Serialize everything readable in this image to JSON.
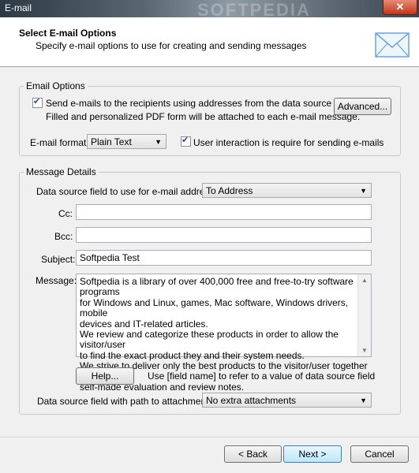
{
  "window": {
    "title": "E-mail",
    "close": "✕",
    "watermark": "SOFTPEDIA"
  },
  "header": {
    "title": "Select E-mail Options",
    "subtitle": "Specify e-mail options to use for creating and sending messages"
  },
  "email_options": {
    "group_label": "Email Options",
    "send_label": "Send e-mails to the recipients using addresses from the data source",
    "send_checked": true,
    "attach_note": "Filled and personalized PDF form will be attached to each e-mail message.",
    "advanced_button": "Advanced...",
    "format_label": "E-mail format:",
    "format_value": "Plain Text",
    "interaction_label": "User interaction is require for sending e-mails",
    "interaction_checked": true
  },
  "message_details": {
    "group_label": "Message Details",
    "address_field_label": "Data source field to use for e-mail address:",
    "address_field_value": "To Address",
    "cc_label": "Cc:",
    "cc_value": "",
    "bcc_label": "Bcc:",
    "bcc_value": "",
    "subject_label": "Subject:",
    "subject_value": "Softpedia Test",
    "message_label": "Message:",
    "message_lines": [
      "Softpedia is a library of over 400,000 free and free-to-try software programs",
      "for Windows and Linux, games, Mac software, Windows drivers, mobile",
      "devices and IT-related articles.",
      "We review and categorize these products in order to allow the visitor/user",
      "to find the exact product they and their system needs.",
      "We strive to deliver only the best products to the visitor/user together with",
      "self-made evaluation and review notes."
    ],
    "help_button": "Help...",
    "help_hint": "Use [field name] to refer to a value of data source field",
    "attachment_label": "Data source field with path to attachment:",
    "attachment_value": "No extra attachments"
  },
  "footer": {
    "back": "< Back",
    "next": "Next >",
    "cancel": "Cancel"
  }
}
